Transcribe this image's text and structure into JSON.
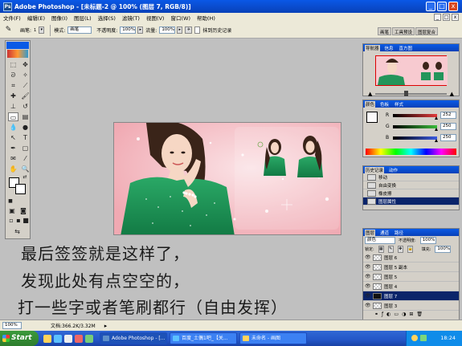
{
  "window": {
    "app_label": "Ps",
    "title": "Adobe Photoshop - [未标题-2 @ 100% (图层 7, RGB/8)]",
    "controls": {
      "minimize": "_",
      "maximize": "□",
      "close": "x"
    }
  },
  "menu": [
    "文件(F)",
    "编辑(E)",
    "图像(I)",
    "图层(L)",
    "选择(S)",
    "滤镜(T)",
    "视图(V)",
    "窗口(W)",
    "帮助(H)"
  ],
  "options_bar": {
    "brush_label": "画笔:",
    "brush_size": "1",
    "mode_label": "模式:",
    "mode_value": "画笔",
    "opacity_label": "不透明度:",
    "opacity_value": "100%",
    "flow_label": "流量:",
    "flow_value": "100%",
    "erase_history_label": "抹到历史记录",
    "palette_well": [
      "画笔",
      "工具预设",
      "图层复合"
    ]
  },
  "navigator": {
    "tabs": [
      "导航器",
      "信息",
      "直方图"
    ]
  },
  "color_palette": {
    "tabs": [
      "颜色",
      "色板",
      "样式"
    ],
    "channels": [
      {
        "label": "R",
        "value": "252",
        "color": "#e23b3b",
        "fill": 0.988
      },
      {
        "label": "G",
        "value": "250",
        "color": "#3bbd3b",
        "fill": 0.98
      },
      {
        "label": "B",
        "value": "250",
        "color": "#3b5be2",
        "fill": 0.98
      }
    ]
  },
  "history": {
    "tabs": [
      "历史记录",
      "动作"
    ],
    "items": [
      "移动",
      "自由变换",
      "橡皮擦",
      "图层属性"
    ]
  },
  "layers": {
    "tabs": [
      "图层",
      "通道",
      "路径"
    ],
    "blend_mode": "颜色",
    "opacity_label": "不透明度:",
    "opacity_value": "100%",
    "lock_label": "锁定:",
    "fill_label": "填充:",
    "fill_value": "100%",
    "items": [
      {
        "name": "图层 6",
        "selected": false
      },
      {
        "name": "图层 5 副本",
        "selected": false
      },
      {
        "name": "图层 5",
        "selected": false
      },
      {
        "name": "图层 4",
        "selected": false
      },
      {
        "name": "图层 7",
        "selected": true
      },
      {
        "name": "图层 3",
        "selected": false
      }
    ]
  },
  "status_bar": {
    "zoom": "100%",
    "doc_info": "文档:366.2K/3.32M"
  },
  "taskbar": {
    "start_label": "Start",
    "tasks": [
      "Adobe Photoshop - [...",
      "百度_土偶1吧_【关...",
      "未命名 - 画图"
    ],
    "clock": "18:24"
  },
  "annotation": {
    "lines": [
      "最后签签就是这样了，",
      "发现此处有点空空的，",
      "打一些字或者笔刷都行（自由发挥）"
    ]
  }
}
